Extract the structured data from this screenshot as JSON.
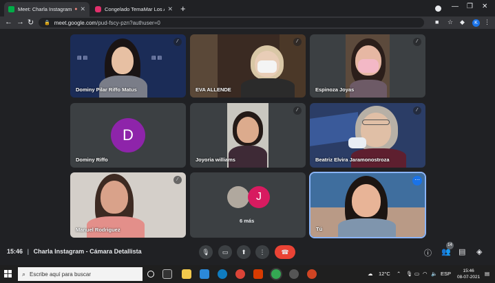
{
  "browser": {
    "tabs": [
      {
        "label": "Meet: Charla Instagram - Cá",
        "active": true
      },
      {
        "label": "Congelado TemaMar Los Angele",
        "active": false
      }
    ],
    "new_tab": "+",
    "url_host": "meet.google.com",
    "url_path": "/pud-fscy-pzn?authuser=0",
    "profile_initial": "K"
  },
  "meet": {
    "participants": [
      {
        "name": "Dominy Pilar Riffo Matus",
        "muted": true
      },
      {
        "name": "EVA ALLENDE",
        "muted": true
      },
      {
        "name": "Espinoza Joyas",
        "muted": true
      },
      {
        "name": "Dominy Riffo",
        "initial": "D",
        "muted": false
      },
      {
        "name": "Joyoria williams",
        "muted": true
      },
      {
        "name": "Beatriz Elvira Jaramonostroza",
        "muted": true
      },
      {
        "name": "Manuel Rodriguez",
        "muted": true
      },
      {
        "name": "Tú",
        "muted": false
      }
    ],
    "more_tile": {
      "initial": "J",
      "label": "6 más"
    },
    "meeting_time": "15:46",
    "meeting_title": "Charla Instagram - Cámara Detallista",
    "people_count": "14",
    "colors": {
      "accent": "#1a73e8",
      "end_call": "#ea4335",
      "avatar_d": "#8e24aa",
      "avatar_j": "#d81b60"
    }
  },
  "taskbar": {
    "search_placeholder": "Escribe aquí para buscar",
    "weather": "12°C",
    "language": "ESP",
    "time": "15:46",
    "date": "08-07-2021"
  }
}
